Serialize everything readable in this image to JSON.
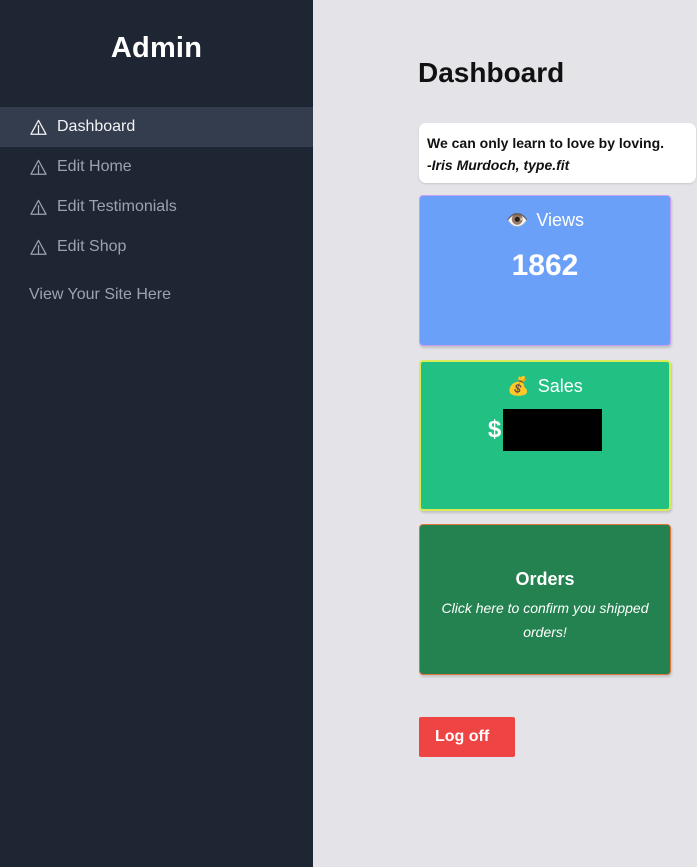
{
  "sidebar": {
    "brand": "Admin",
    "items": [
      {
        "label": "Dashboard",
        "icon": "triangle-warning-icon",
        "active": true
      },
      {
        "label": "Edit Home",
        "icon": "triangle-warning-icon",
        "active": false
      },
      {
        "label": "Edit Testimonials",
        "icon": "triangle-warning-icon",
        "active": false
      },
      {
        "label": "Edit Shop",
        "icon": "triangle-warning-icon",
        "active": false
      }
    ],
    "site_link": "View Your Site Here"
  },
  "main": {
    "title": "Dashboard",
    "quote": {
      "text": "We can only learn to love by loving.",
      "author": "-Iris Murdoch, type.fit"
    },
    "views": {
      "emoji": "👁️",
      "label": "Views",
      "value": "1862"
    },
    "sales": {
      "emoji": "💰",
      "label": "Sales",
      "currency": "$"
    },
    "orders": {
      "title": "Orders",
      "subtitle": "Click here to confirm you shipped orders!"
    },
    "logoff_label": "Log off"
  },
  "colors": {
    "sidebar_bg": "#1f2633",
    "sidebar_active": "#343d4e",
    "main_bg": "#e4e4e8",
    "views_card": "#6aa0f7",
    "sales_card": "#22c083",
    "orders_card": "#23824f",
    "logoff_button": "#ef4444"
  }
}
